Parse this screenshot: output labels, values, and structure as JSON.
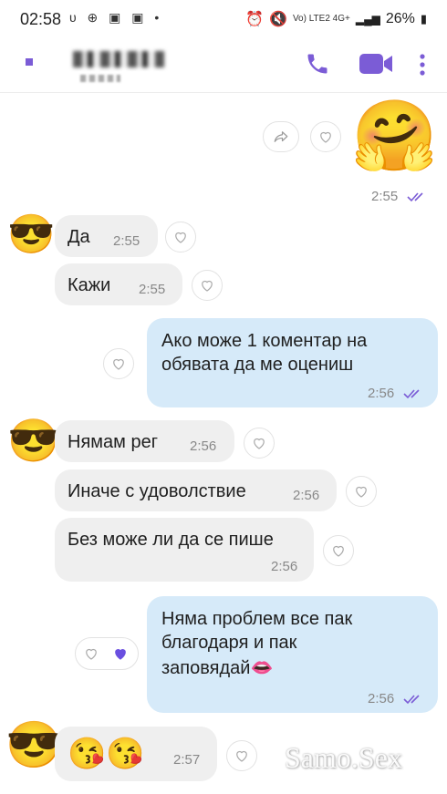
{
  "status_bar": {
    "time": "02:58",
    "dots": "υ ⊕ ▣ ▣ •",
    "network": "Vo) LTE2 4G+",
    "battery": "26%"
  },
  "header": {
    "contact_name": "",
    "contact_status": ""
  },
  "messages": [
    {
      "id": "m0",
      "dir": "out",
      "type": "sticker",
      "emoji": "🤗",
      "time": "2:55"
    },
    {
      "id": "m1",
      "dir": "in",
      "text": "Да",
      "time": "2:55"
    },
    {
      "id": "m2",
      "dir": "in",
      "text": "Кажи",
      "time": "2:55"
    },
    {
      "id": "m3",
      "dir": "out",
      "text_line1": "Ако може 1 коментар на",
      "text_line2": "обявата да ме оцениш",
      "time": "2:56"
    },
    {
      "id": "m4",
      "dir": "in",
      "text": "Нямам рег",
      "time": "2:56"
    },
    {
      "id": "m5",
      "dir": "in",
      "text": "Иначе с удоволствие",
      "time": "2:56"
    },
    {
      "id": "m6",
      "dir": "in",
      "text": "Без може ли да се пише",
      "time": "2:56"
    },
    {
      "id": "m7",
      "dir": "out",
      "text_line1": "Няма проблем все пак",
      "text_line2": "благодаря и пак",
      "text_line3": "заповядай👄",
      "time": "2:56",
      "liked": true
    },
    {
      "id": "m8",
      "dir": "in",
      "text": "😘😘",
      "time": "2:57"
    }
  ],
  "avatar_emoji": "😎",
  "watermark": "Samo.Sex",
  "colors": {
    "accent": "#7b5cd6",
    "out_bubble": "#d6eaf9",
    "in_bubble": "#efefef"
  }
}
